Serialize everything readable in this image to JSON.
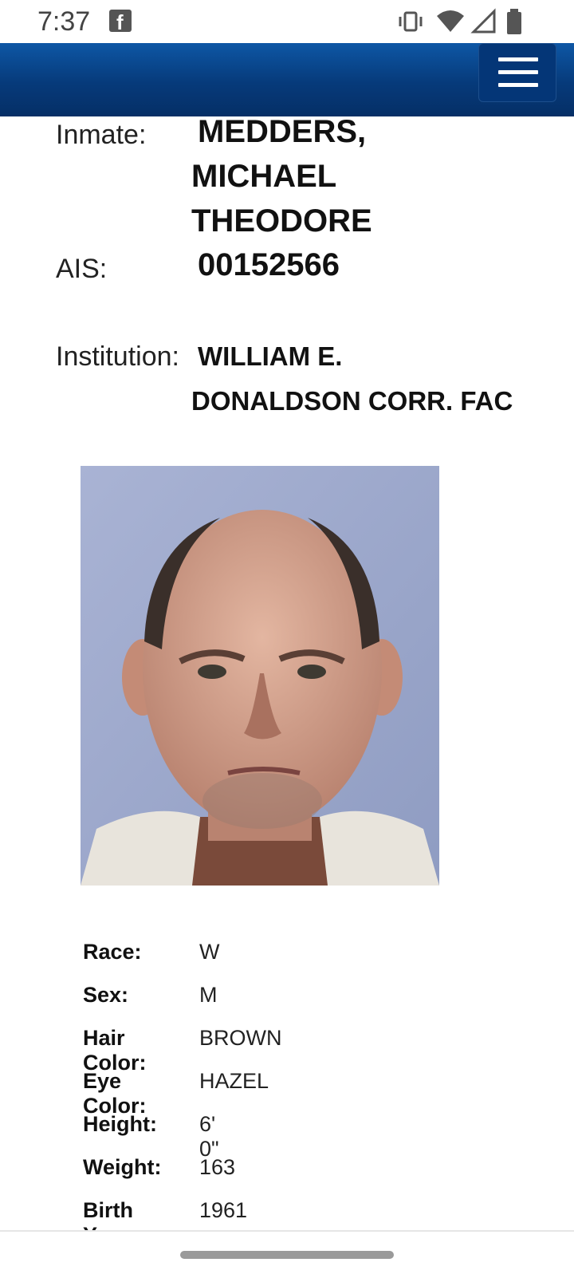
{
  "status_bar": {
    "time": "7:37"
  },
  "inmate": {
    "inmate_label": "Inmate:",
    "name_line1": "MEDDERS,",
    "name_line2": "MICHAEL",
    "name_line3": "THEODORE",
    "ais_label": "AIS:",
    "ais_value": "00152566",
    "institution_label": "Institution:",
    "institution_line1": "WILLIAM E.",
    "institution_line2": "DONALDSON CORR. FAC"
  },
  "details": [
    {
      "label": "Race:",
      "value": "W"
    },
    {
      "label": "Sex:",
      "value": "M"
    },
    {
      "label": "Hair Color:",
      "value": "BROWN"
    },
    {
      "label": "Eye Color:",
      "value": "HAZEL"
    },
    {
      "label": "Height:",
      "value": "6' 0\""
    },
    {
      "label": "Weight:",
      "value": "163"
    },
    {
      "label": "Birth Year:",
      "value": "1961"
    }
  ],
  "colors": {
    "header_blue": "#063a7a",
    "photo_background": "#a3aed0"
  }
}
